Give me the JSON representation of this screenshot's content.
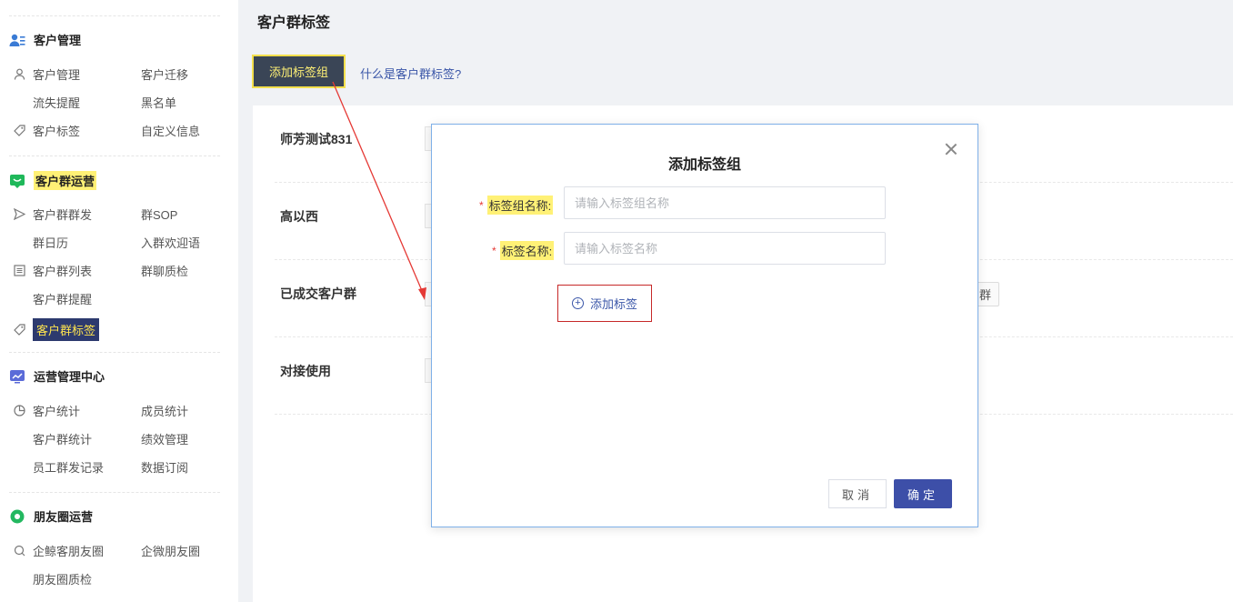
{
  "sidebar": {
    "sections": [
      {
        "title": "客户管理",
        "icon": "user-group-icon",
        "color": "#3a7bd5",
        "highlight": false,
        "items": [
          {
            "label": "客户管理",
            "icon": "person-icon",
            "col": 0,
            "row": 0
          },
          {
            "label": "客户迁移",
            "icon": "",
            "col": 1,
            "row": 0
          },
          {
            "label": "流失提醒",
            "icon": "",
            "col": 0,
            "row": 1
          },
          {
            "label": "黑名单",
            "icon": "",
            "col": 1,
            "row": 1
          },
          {
            "label": "客户标签",
            "icon": "tag-icon",
            "col": 0,
            "row": 2
          },
          {
            "label": "自定义信息",
            "icon": "",
            "col": 1,
            "row": 2
          }
        ]
      },
      {
        "title": "客户群运营",
        "icon": "chat-bubble-icon",
        "color": "#1fb85a",
        "highlight": true,
        "items": [
          {
            "label": "客户群群发",
            "icon": "send-icon",
            "col": 0,
            "row": 0
          },
          {
            "label": "群SOP",
            "icon": "",
            "col": 1,
            "row": 0
          },
          {
            "label": "群日历",
            "icon": "",
            "col": 0,
            "row": 1
          },
          {
            "label": "入群欢迎语",
            "icon": "",
            "col": 1,
            "row": 1
          },
          {
            "label": "客户群列表",
            "icon": "list-icon",
            "col": 0,
            "row": 2
          },
          {
            "label": "群聊质检",
            "icon": "",
            "col": 1,
            "row": 2
          },
          {
            "label": "客户群提醒",
            "icon": "",
            "col": 0,
            "row": 3
          },
          {
            "label": "客户群标签",
            "icon": "tag-icon",
            "col": 0,
            "row": 4,
            "active": true
          }
        ]
      },
      {
        "title": "运营管理中心",
        "icon": "chart-trend-icon",
        "color": "#5b6bd8",
        "highlight": false,
        "items": [
          {
            "label": "客户统计",
            "icon": "pie-chart-icon",
            "col": 0,
            "row": 0
          },
          {
            "label": "成员统计",
            "icon": "",
            "col": 1,
            "row": 0
          },
          {
            "label": "客户群统计",
            "icon": "",
            "col": 0,
            "row": 1
          },
          {
            "label": "绩效管理",
            "icon": "",
            "col": 1,
            "row": 1
          },
          {
            "label": "员工群发记录",
            "icon": "",
            "col": 0,
            "row": 2
          },
          {
            "label": "数据订阅",
            "icon": "",
            "col": 1,
            "row": 2
          }
        ]
      },
      {
        "title": "朋友圈运营",
        "icon": "moments-icon",
        "color": "#23b860",
        "highlight": false,
        "items": [
          {
            "label": "企鲸客朋友圈",
            "icon": "moments-outline-icon",
            "col": 0,
            "row": 0
          },
          {
            "label": "企微朋友圈",
            "icon": "",
            "col": 1,
            "row": 0
          },
          {
            "label": "朋友圈质检",
            "icon": "",
            "col": 0,
            "row": 1
          }
        ]
      }
    ]
  },
  "main": {
    "title": "客户群标签",
    "add_group_button": "添加标签组",
    "help_link": "什么是客户群标签?",
    "groups": [
      {
        "name": "师芳测试831"
      },
      {
        "name": "高以西"
      },
      {
        "name": "已成交客户群",
        "tag_fragment": "户群"
      },
      {
        "name": "对接使用"
      }
    ]
  },
  "modal": {
    "title": "添加标签组",
    "fields": [
      {
        "required_mark": "*",
        "label": "标签组名称:",
        "placeholder": "请输入标签组名称",
        "value": ""
      },
      {
        "required_mark": "*",
        "label": "标签名称:",
        "placeholder": "请输入标签名称",
        "value": ""
      }
    ],
    "add_tag_label": "添加标签",
    "cancel_label": "取消",
    "ok_label": "确定"
  },
  "colors": {
    "accent": "#3d4fa8",
    "highlight_yellow": "#fff176",
    "annotation_red": "#e53935"
  }
}
